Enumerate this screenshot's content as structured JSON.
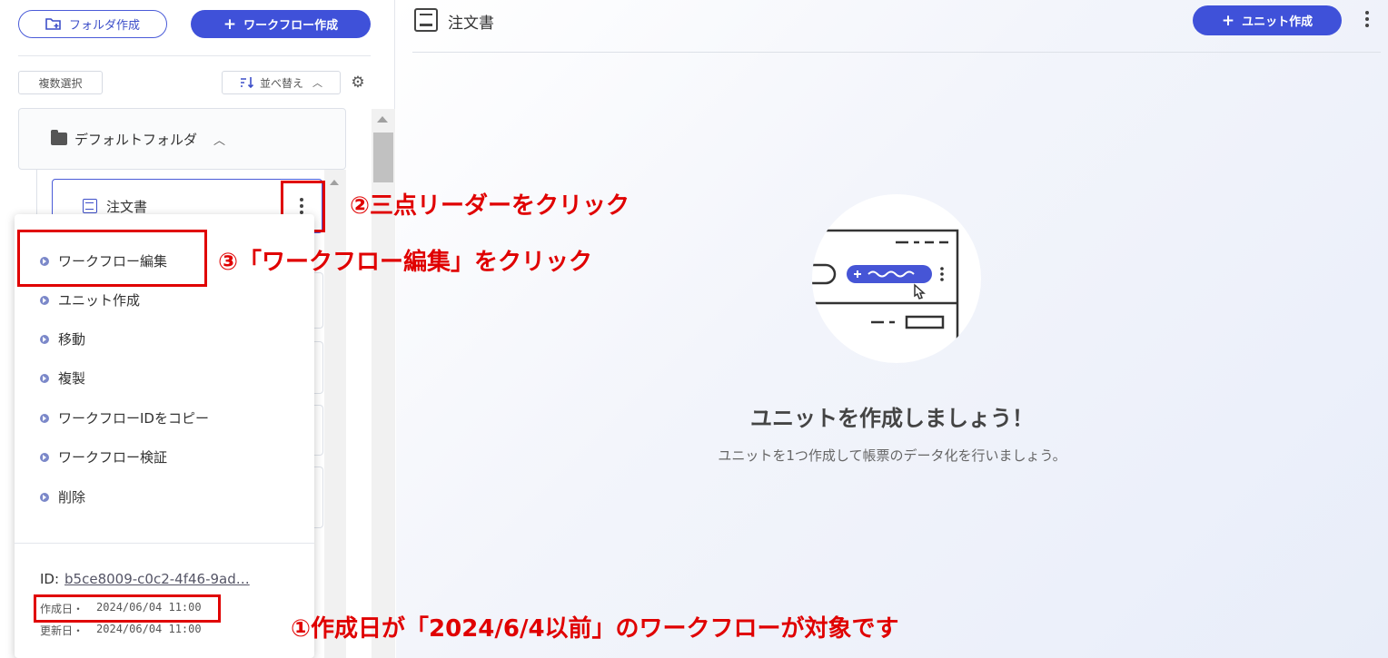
{
  "sidebar": {
    "create_folder_label": "フォルダ作成",
    "create_workflow_label": "ワークフロー作成",
    "multi_select_label": "複数選択",
    "sort_label": "並べ替え",
    "folder_name": "デフォルトフォルダ",
    "workflow_name": "注文書"
  },
  "context_menu": {
    "items": [
      {
        "label": "ワークフロー編集"
      },
      {
        "label": "ユニット作成"
      },
      {
        "label": "移動"
      },
      {
        "label": "複製"
      },
      {
        "label": "ワークフローIDをコピー"
      },
      {
        "label": "ワークフロー検証"
      },
      {
        "label": "削除"
      }
    ],
    "id_label": "ID:",
    "id_value": "b5ce8009-c0c2-4f46-9ad…",
    "created_label": "作成日・",
    "created_value": "2024/06/04 11:00",
    "updated_label": "更新日・",
    "updated_value": "2024/06/04 11:00"
  },
  "annotations": {
    "step1": "①作成日が「2024/6/4以前」のワークフローが対象です",
    "step2": "②三点リーダーをクリック",
    "step3": "③「ワークフロー編集」をクリック"
  },
  "main": {
    "title": "注文書",
    "create_unit_label": "ユニット作成",
    "empty_title": "ユニットを作成しましょう！",
    "empty_subtitle": "ユニットを1つ作成して帳票のデータ化を行いましょう。"
  },
  "colors": {
    "primary": "#3f51d9",
    "highlight_red": "#e00000"
  }
}
